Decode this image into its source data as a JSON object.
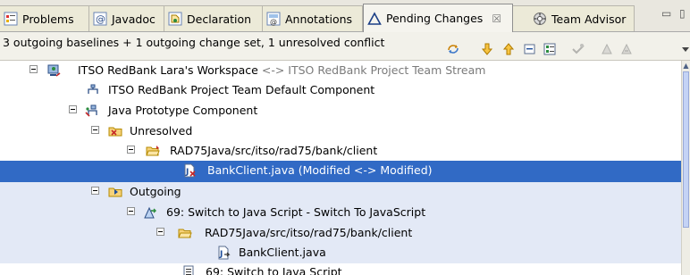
{
  "tabs": [
    {
      "label": "Problems",
      "icon": "problems-icon"
    },
    {
      "label": "Javadoc",
      "icon": "javadoc-icon"
    },
    {
      "label": "Declaration",
      "icon": "declaration-icon"
    },
    {
      "label": "Annotations",
      "icon": "annotations-icon"
    },
    {
      "label": "Pending Changes",
      "icon": "pending-changes-icon",
      "active": true
    },
    {
      "label": "Team Advisor",
      "icon": "team-advisor-icon"
    }
  ],
  "close_glyph": "☒",
  "window_controls": {
    "minimize": "▭",
    "maximize": "▯"
  },
  "status_text": "3 outgoing baselines + 1 outgoing change set, 1 unresolved conflict",
  "toolbar_icons": [
    "refresh-icon",
    "collapse-down-icon",
    "collapse-up-icon",
    "collapse-all-icon",
    "expand-all-icon",
    "accept-icon",
    "deliver-icon",
    "resolve-icon",
    "menu-icon"
  ],
  "tree": {
    "workspace": {
      "name": "ITSO RedBank Lara's Workspace",
      "relation": "<-> ITSO RedBank Project Team Stream"
    },
    "default_component": "ITSO RedBank Project Team Default Component",
    "java_component": "Java Prototype Component",
    "unresolved": "Unresolved",
    "unresolved_folder": "RAD75Java/src/itso/rad75/bank/client",
    "conflict_file": "BankClient.java (Modified <-> Modified)",
    "outgoing": "Outgoing",
    "change_set": "69: Switch to Java Script - Switch To JavaScript",
    "outgoing_folder": "RAD75Java/src/itso/rad75/bank/client",
    "outgoing_file": "BankClient.java",
    "partial_item": "69: Switch to Java Script"
  },
  "colors": {
    "selection": "#316ac5",
    "band": "#e3e9f6",
    "tab_bg": "#e9e7df"
  }
}
